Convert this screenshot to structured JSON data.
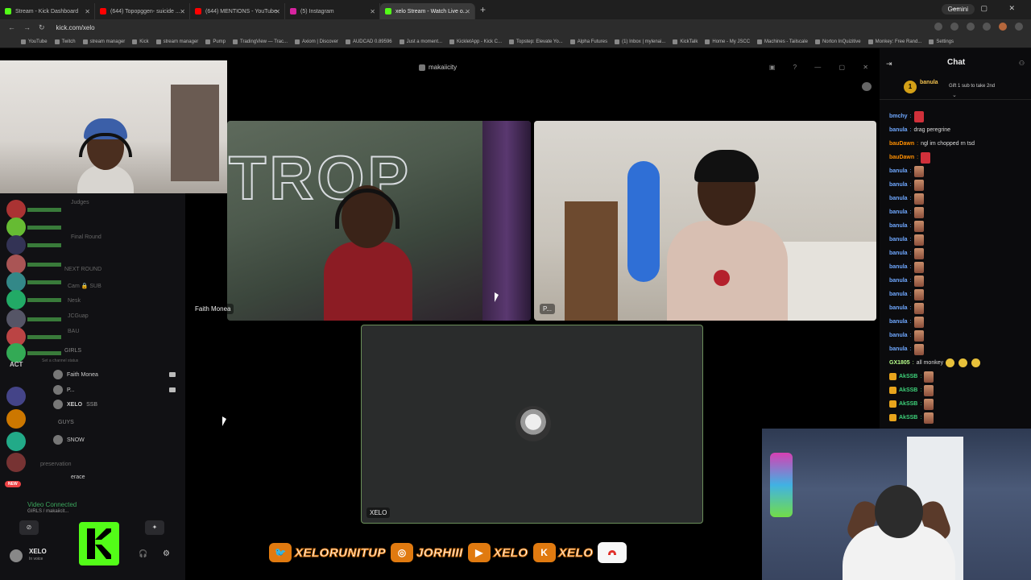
{
  "browser": {
    "tabs": [
      {
        "label": "Stream - Kick Dashboard",
        "color": "#53fc18",
        "active": false
      },
      {
        "label": "(644) Topopggen- suicide ...",
        "color": "#ff0000",
        "active": false
      },
      {
        "label": "(644) MENTIONS - YouTube",
        "color": "#ff0000",
        "active": false
      },
      {
        "label": "(5) Instagram",
        "color": "#d6249f",
        "active": false
      },
      {
        "label": "xelo Stream - Watch Live o...",
        "color": "#53fc18",
        "active": true
      }
    ],
    "gemini_label": "Gemini",
    "url": "kick.com/xelo",
    "bookmarks": [
      "YouTube",
      "Twitch",
      "stream manager",
      "Kick",
      "stream manager",
      "Pump",
      "TradingView — Trac...",
      "Axiom | Discover",
      "AUDCAD 0.89596",
      "Just a moment...",
      "KickletApp - Kick C...",
      "Topstep: Elevate Yo...",
      "Alpha Futures",
      "(1) Inbox | mylenai...",
      "KickTalk",
      "Home - My JSCC",
      "Machines - Tailscale",
      "Norton InQuizitive",
      "Monkey: Free Rand...",
      "Settings"
    ]
  },
  "discord": {
    "window_title": "makaiicity",
    "participants": {
      "faith": "Faith Monea",
      "p": "P...",
      "xelo": "XELO"
    },
    "act_label": "ACT",
    "channels": {
      "judges": "Judges",
      "final_round": "Final Round",
      "next_round": "NEXT ROUND",
      "cam_sub": "Cam 🔒 SUB",
      "nesk": "Nesk",
      "jcguap": "JCGuap",
      "bau": "BAU",
      "girls": "GIRLS",
      "status_placeholder": "Set a channel status",
      "voice_users": [
        "Faith Monea",
        "P...",
        "XELO"
      ],
      "xelo_tag": "SSB",
      "guys": "GUYS",
      "guys_user_tag": "SNOW",
      "preservation": "preservation",
      "erace": "erace"
    },
    "video_connected": "Video Connected",
    "video_sub": "GIRLS / makaiicit...",
    "user_name": "XELO",
    "user_status": "In voice",
    "new_badge": "NEW"
  },
  "socials": [
    {
      "icon": "twitter-icon",
      "glyph": "🐦",
      "bg": "#e07a10",
      "label": "XELORUNITUP"
    },
    {
      "icon": "instagram-icon",
      "glyph": "◎",
      "bg": "#e07a10",
      "label": "JORHIII"
    },
    {
      "icon": "youtube-icon",
      "glyph": "▶",
      "bg": "#e07a10",
      "label": "XELO"
    },
    {
      "icon": "kick-icon",
      "glyph": "K",
      "bg": "#e07a10",
      "label": "XELO"
    }
  ],
  "chat": {
    "title": "Chat",
    "pinned": {
      "user": "banula",
      "message": "Gift 1 sub to take 2nd",
      "rank": "1"
    },
    "messages": [
      {
        "user": "bmchy",
        "color": "#6fa8ff",
        "text": "",
        "emotes": 1
      },
      {
        "user": "banula",
        "color": "#6fa8ff",
        "text": "drag peregrine",
        "emotes": 0
      },
      {
        "user": "bauDawn",
        "color": "#ff8f00",
        "text": "ngl im chopped rn tsd",
        "emotes": 0
      },
      {
        "user": "bauDawn",
        "color": "#ff8f00",
        "text": "",
        "emotes": 1
      },
      {
        "user": "banula",
        "color": "#6fa8ff",
        "text": "",
        "emotes": 1
      },
      {
        "user": "banula",
        "color": "#6fa8ff",
        "text": "",
        "emotes": 1
      },
      {
        "user": "banula",
        "color": "#6fa8ff",
        "text": "",
        "emotes": 1
      },
      {
        "user": "banula",
        "color": "#6fa8ff",
        "text": "",
        "emotes": 1
      },
      {
        "user": "banula",
        "color": "#6fa8ff",
        "text": "",
        "emotes": 1
      },
      {
        "user": "banula",
        "color": "#6fa8ff",
        "text": "",
        "emotes": 1
      },
      {
        "user": "banula",
        "color": "#6fa8ff",
        "text": "",
        "emotes": 1
      },
      {
        "user": "banula",
        "color": "#6fa8ff",
        "text": "",
        "emotes": 1
      },
      {
        "user": "banula",
        "color": "#6fa8ff",
        "text": "",
        "emotes": 1
      },
      {
        "user": "banula",
        "color": "#6fa8ff",
        "text": "",
        "emotes": 1
      },
      {
        "user": "banula",
        "color": "#6fa8ff",
        "text": "",
        "emotes": 1
      },
      {
        "user": "banula",
        "color": "#6fa8ff",
        "text": "",
        "emotes": 1
      },
      {
        "user": "banula",
        "color": "#6fa8ff",
        "text": "",
        "emotes": 1
      },
      {
        "user": "banula",
        "color": "#6fa8ff",
        "text": "",
        "emotes": 1
      },
      {
        "user": "GX1805",
        "color": "#b7ff8a",
        "text": "all monkey",
        "emotes": 3,
        "emote_type": "monkey"
      },
      {
        "user": "AkSSB",
        "color": "#3ed27a",
        "text": "",
        "emotes": 1,
        "badge": true
      },
      {
        "user": "AkSSB",
        "color": "#3ed27a",
        "text": "",
        "emotes": 1,
        "badge": true
      },
      {
        "user": "AkSSB",
        "color": "#3ed27a",
        "text": "",
        "emotes": 1,
        "badge": true
      },
      {
        "user": "AkSSB",
        "color": "#3ed27a",
        "text": "",
        "emotes": 1,
        "badge": true
      }
    ]
  }
}
